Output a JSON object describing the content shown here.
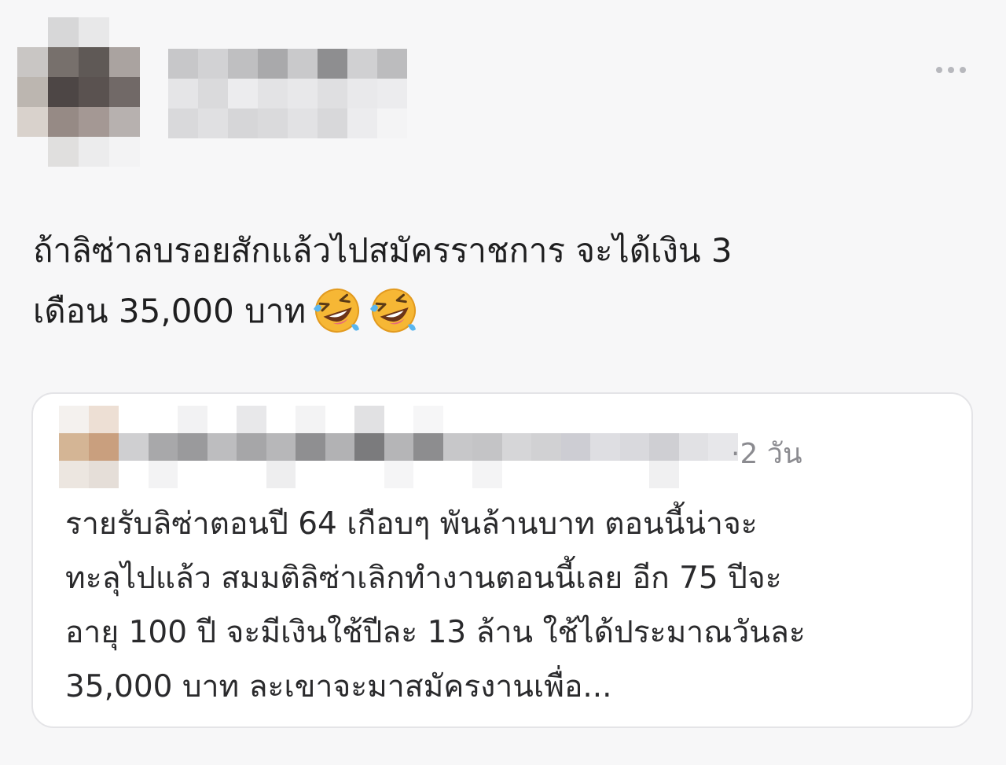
{
  "post": {
    "text": "ถ้าลิซ่าลบรอยสักแล้วไปสมัครราชการ จะได้เงิน 3\nเดือน 35,000 บาท",
    "emojis": [
      "rolling-on-floor-laughing-emoji",
      "rolling-on-floor-laughing-emoji"
    ],
    "author_blurred": true
  },
  "quote": {
    "time": "·2 วัน",
    "text": "รายรับลิซ่าตอนปี 64 เกือบๆ พันล้านบาท ตอนนี้น่าจะ\nทะลุไปแล้ว สมมติลิซ่าเลิกทำงานตอนนี้เลย อีก 75 ปีจะ\nอายุ 100 ปี จะมีเงินใช้ปีละ 13 ล้าน ใช้ได้ประมาณวันละ\n35,000 บาท ละเขาจะมาสมัครงานเพื่อ...",
    "author_blurred": true
  },
  "icons": {
    "more": "more-horizontal-icon"
  },
  "colors": {
    "background": "#f7f7f8",
    "text": "#1f1f20",
    "muted": "#8b8b90",
    "card_border": "#e4e4e7"
  }
}
